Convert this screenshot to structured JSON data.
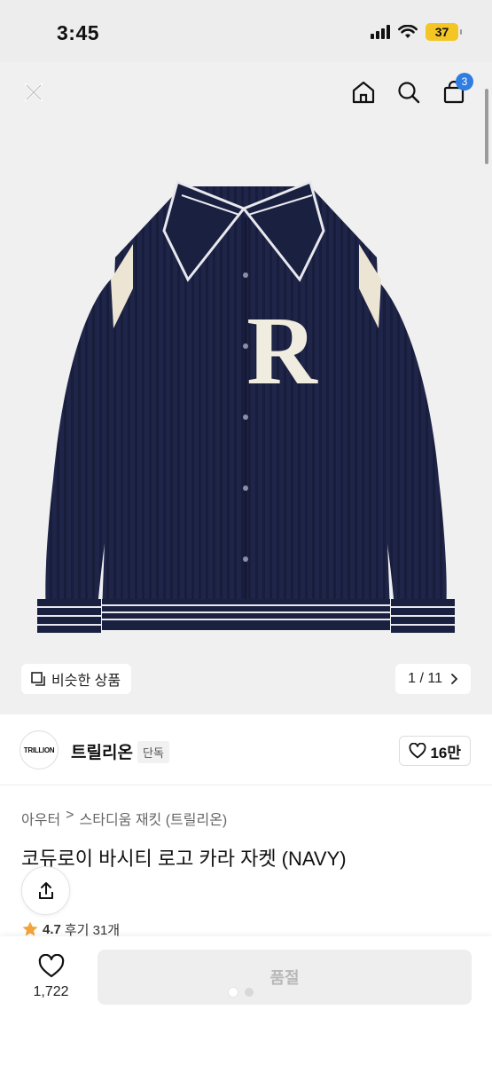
{
  "status_bar": {
    "time": "3:45",
    "battery": "37"
  },
  "nav": {
    "cart_count": "3"
  },
  "gallery": {
    "similar_label": "비슷한 상품",
    "page_indicator": "1 / 11",
    "logo_letter": "R"
  },
  "brand": {
    "logo_text": "TRILLION",
    "name": "트릴리온",
    "tag": "단독",
    "likes": "16만"
  },
  "breadcrumb": {
    "category": "아우터",
    "separator": ">",
    "subcategory": "스타디움 재킷 (트릴리온)"
  },
  "product": {
    "title": "코듀로이 바시티 로고 카라 자켓 (NAVY)"
  },
  "rating": {
    "score": "4.7",
    "reviews": "후기 31개"
  },
  "bottom_bar": {
    "wish_count": "1,722",
    "buy_label": "품절"
  },
  "colors": {
    "accent": "#2f7de1",
    "jacket": "#1d2345",
    "battery": "#f3c623"
  }
}
